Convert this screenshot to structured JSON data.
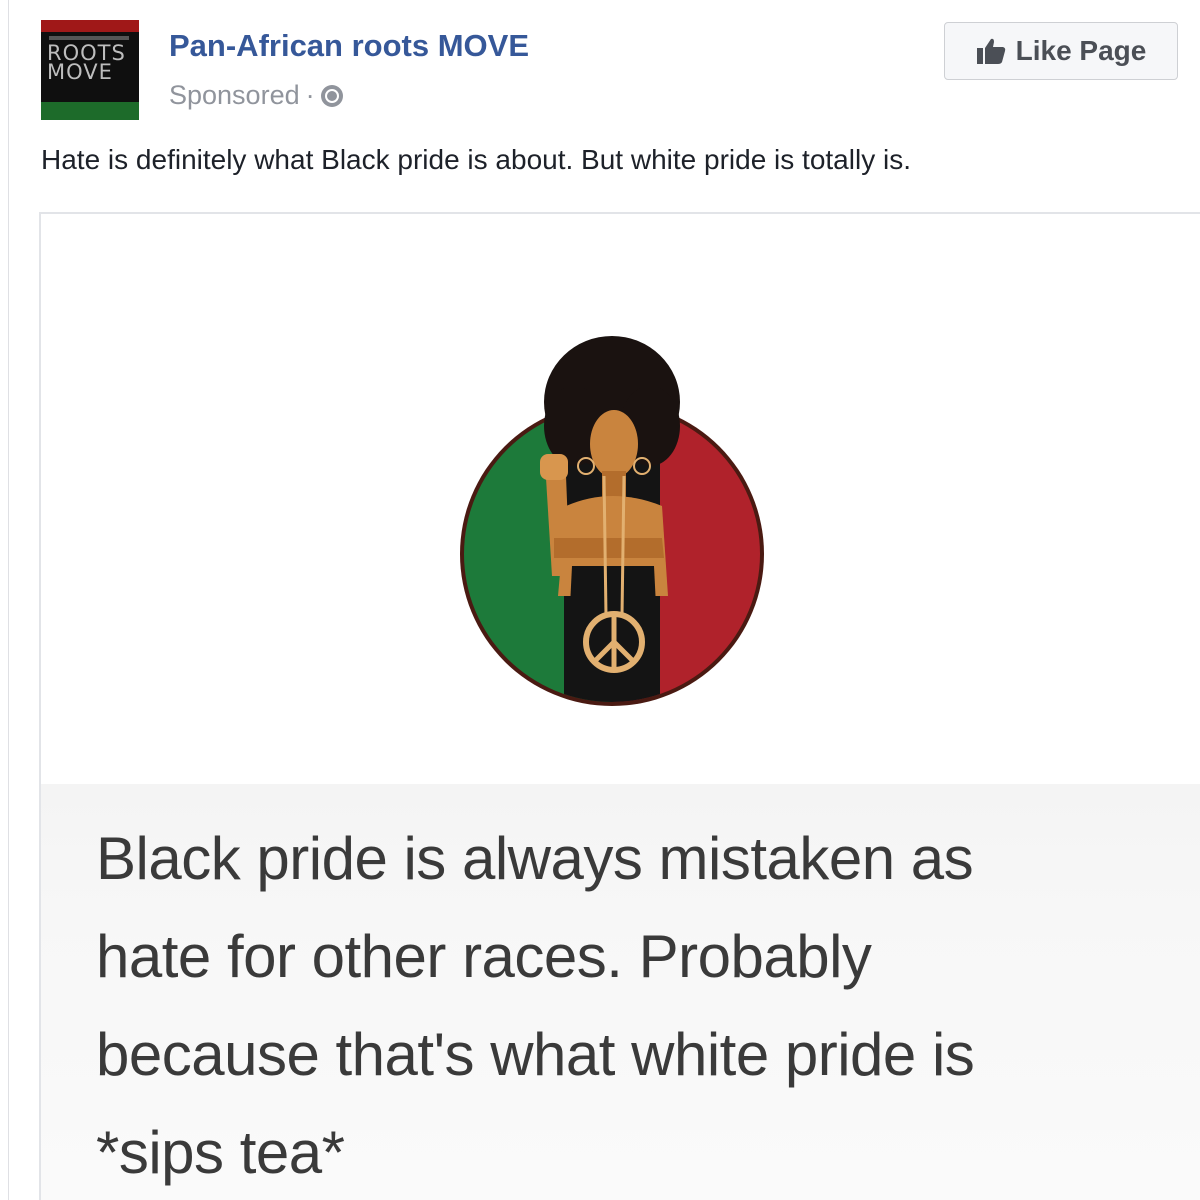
{
  "post": {
    "page_name": "Pan-African roots MOVE",
    "avatar_text": [
      "ROOTS",
      "MOVE"
    ],
    "sponsored_label": "Sponsored",
    "separator": "·",
    "privacy_icon": "globe-icon",
    "like_button_label": "Like Page",
    "like_button_icon": "thumbs-up-icon",
    "caption": "Hate is definitely what Black pride is about. But white pride is totally is."
  },
  "image": {
    "emblem_colors": {
      "left": "#1d7a3a",
      "right": "#b0222b",
      "ring": "#4a1a12"
    },
    "quote_lines": [
      "Black pride is always mistaken as",
      "hate for other races. Probably",
      "because that's what white pride is",
      "*sips tea*"
    ]
  },
  "colors": {
    "link": "#365899",
    "meta": "#90949c",
    "text": "#1d2129",
    "button_bg": "#f6f7f9"
  }
}
